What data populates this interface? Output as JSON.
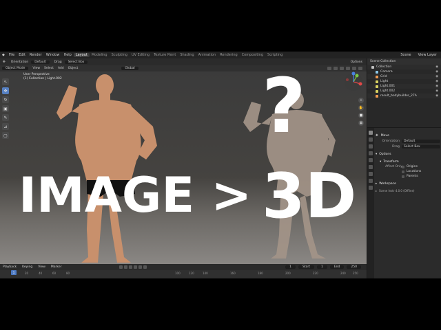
{
  "menubar": {
    "menu": [
      "File",
      "Edit",
      "Render",
      "Window",
      "Help"
    ],
    "workspaces": [
      "Layout",
      "Modeling",
      "Sculpting",
      "UV Editing",
      "Texture Paint",
      "Shading",
      "Animation",
      "Rendering",
      "Compositing",
      "Scripting"
    ],
    "scene": "Scene",
    "view_layer": "View Layer"
  },
  "toolheader": {
    "orientation_label": "Orientation",
    "orientation_value": "Default",
    "drag_label": "Drag",
    "drag_value": "Select Box",
    "options": "Options"
  },
  "viewport_header": {
    "mode": "Object Mode",
    "menu": [
      "View",
      "Select",
      "Add",
      "Object"
    ],
    "transform": "Global"
  },
  "viewport": {
    "info_line1": "User Perspective",
    "info_line2": "(1) Collection | Light.002"
  },
  "overlay": {
    "headline_left": "IMAGE >",
    "headline_right": "3D",
    "question": "?"
  },
  "timeline": {
    "menu": [
      "Playback",
      "Keying",
      "View",
      "Marker"
    ],
    "current_frame": "1",
    "start_label": "Start",
    "start": "1",
    "end_label": "End",
    "end": "250",
    "ticks": [
      "1",
      "20",
      "40",
      "60",
      "80",
      "100",
      "120",
      "140",
      "160",
      "180",
      "200",
      "220",
      "240",
      "250"
    ]
  },
  "outliner": {
    "title": "Scene Collection",
    "items": [
      {
        "name": "Collection",
        "type": "col"
      },
      {
        "name": "Camera",
        "type": "cam"
      },
      {
        "name": "Grid",
        "type": "mesh"
      },
      {
        "name": "Light",
        "type": "light"
      },
      {
        "name": "Light.001",
        "type": "light"
      },
      {
        "name": "Light.002",
        "type": "light"
      },
      {
        "name": "result_bodybuilder_27A",
        "type": "mesh"
      }
    ]
  },
  "properties": {
    "section_move": "Move",
    "orientation_label": "Orientation",
    "orientation_value": "Default",
    "drag_label": "Drag",
    "drag_value": "Select Box",
    "options": "Options",
    "transform": "Transform",
    "affect_only": "Affect Only",
    "origins": "Origins",
    "locations": "Locations",
    "parents": "Parents",
    "workspace": "Workspace",
    "status": "Scene Instr 4.0.0 (Offline)"
  }
}
